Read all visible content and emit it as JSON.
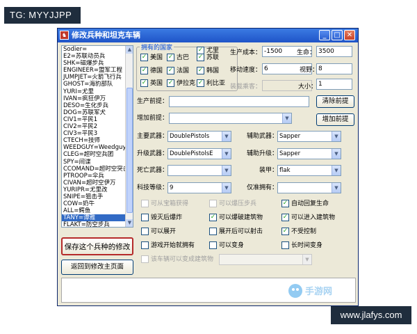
{
  "overlay": {
    "top_tag": "TG: MYYJJPP",
    "bottom_tag": "www.jlafys.com"
  },
  "window": {
    "title": "修改兵种和坦克车辆",
    "icon_glyph": "♞"
  },
  "units": [
    "Sodier=",
    "E2=苏联动员兵",
    "SHK=磁爆步兵",
    "ENGINEER=盟军工程",
    "JUMPJET=火箭飞行兵",
    "GHOST=海豹部队",
    "YURI=尤里",
    "IVAN=疯狂伊万",
    "DESO=生化步兵",
    "DOG=苏联军犬",
    "CIV1=平民1",
    "CIV2=平民2",
    "CIV3=平民3",
    "CTECH=技师",
    "WEEDGUY=Weedguy",
    "CLEG=超时空兵团",
    "SPY=间谍",
    "CCOMAND=超时空突击",
    "PTROOP=伞兵",
    "CIVAN=超时空伊万",
    "YURIPR=尤里改",
    "SNIPE=狙击手",
    "COW=奶牛",
    "ALL=鳄鱼",
    "TANY=谭雅",
    "FLAKT=防空步兵"
  ],
  "selected_unit_index": 24,
  "countries": {
    "title": "拥有的国家",
    "items": [
      {
        "label": "美国",
        "checked": true
      },
      {
        "label": "古巴",
        "checked": true
      },
      {
        "label": "尤里",
        "checked": true
      },
      {
        "label": "德国",
        "checked": true
      },
      {
        "label": "法国",
        "checked": true
      },
      {
        "label": "苏联",
        "checked": true
      },
      {
        "label": "英国",
        "checked": true
      },
      {
        "label": "伊拉克",
        "checked": true
      },
      {
        "label": "韩国",
        "checked": true
      },
      {
        "label": "利比亚",
        "checked": true
      }
    ]
  },
  "stats": {
    "cost_label": "生产成本：",
    "cost_value": "-1500",
    "life_label": "生命：",
    "life_value": "3500",
    "speed_label": "移动速度：",
    "speed_value": "6",
    "sight_label": "视野：",
    "sight_value": "8",
    "passengers_label": "装载乘客：",
    "passengers_value": "",
    "size_label": "大小：",
    "size_value": "1"
  },
  "prereq": {
    "label": "生产前提：",
    "value": "",
    "clear_button": "清除前提",
    "add_label": "增加前提：",
    "add_value": "",
    "add_button": "增加前提"
  },
  "weapons": {
    "primary_label": "主要武器：",
    "primary_value": "DoublePistols",
    "secondary_label": "辅助武器：",
    "secondary_value": "Sapper",
    "elite_primary_label": "升级武器：",
    "elite_primary_value": "DoublePistolsE",
    "elite_secondary_label": "辅助升级：",
    "elite_secondary_value": "Sapper",
    "death_label": "死亡武器：",
    "death_value": "",
    "armor_label": "装甲：",
    "armor_value": "flak",
    "tech_label": "科技等级：",
    "tech_value": "9",
    "only_label": "仅准拥有：",
    "only_value": ""
  },
  "options": [
    {
      "label": "可从宝箱获得",
      "checked": false,
      "disabled": true
    },
    {
      "label": "可以爆压步兵",
      "checked": false,
      "disabled": true
    },
    {
      "label": "自动回复生命",
      "checked": true,
      "disabled": false
    },
    {
      "label": "毁灭后爆炸",
      "checked": false,
      "disabled": false
    },
    {
      "label": "可以爆破建筑物",
      "checked": true,
      "disabled": false
    },
    {
      "label": "可以进入建筑物",
      "checked": true,
      "disabled": false
    },
    {
      "label": "可以展开",
      "checked": false,
      "disabled": false
    },
    {
      "label": "展开后可以射击",
      "checked": false,
      "disabled": false
    },
    {
      "label": "不受控制",
      "checked": true,
      "disabled": false
    },
    {
      "label": "游戏开始就拥有",
      "checked": false,
      "disabled": false
    },
    {
      "label": "可以变身",
      "checked": false,
      "disabled": false
    },
    {
      "label": "长时间变身",
      "checked": false,
      "disabled": false
    },
    {
      "label": "该车辆可以变成建筑物",
      "checked": false,
      "disabled": true
    }
  ],
  "buttons": {
    "save": "保存这个兵种的修改",
    "back": "返回到修改主页面"
  },
  "watermark": {
    "text": "手游网"
  }
}
